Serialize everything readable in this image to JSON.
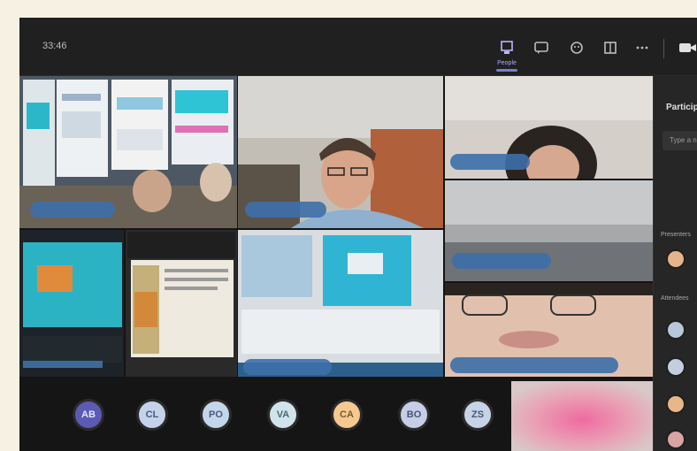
{
  "window": {
    "timer": "33:46"
  },
  "toolbar": {
    "view_label": "People",
    "buttons": [
      "people-view-icon",
      "chat-icon",
      "reactions-icon",
      "rooms-icon",
      "more-icon",
      "camera-icon"
    ]
  },
  "stage": {
    "participants": [
      {
        "name": "",
        "kind": "screen-share"
      },
      {
        "name": "",
        "kind": "camera"
      },
      {
        "name": "",
        "kind": "camera"
      },
      {
        "name": "",
        "kind": "camera"
      },
      {
        "name": "",
        "kind": "screen-share"
      },
      {
        "name": "",
        "kind": "document"
      },
      {
        "name": "",
        "kind": "screen-share"
      },
      {
        "name": "",
        "kind": "camera"
      }
    ]
  },
  "avatar_strip": {
    "avatars": [
      {
        "initials": "AB",
        "color": "#5b5bb5"
      },
      {
        "initials": "CL",
        "color": "#c4d3ea"
      },
      {
        "initials": "PO",
        "color": "#c4d7ea"
      },
      {
        "initials": "VA",
        "color": "#d1e4ec"
      },
      {
        "initials": "CA",
        "color": "#f5c98f"
      },
      {
        "initials": "BO",
        "color": "#c6cee8"
      },
      {
        "initials": "ZS",
        "color": "#c7d3e6"
      }
    ]
  },
  "panel": {
    "title": "Participants",
    "search_placeholder": "Type a name",
    "sections": [
      {
        "label": "Presenters"
      },
      {
        "label": "Attendees"
      }
    ]
  },
  "colors": {
    "background": "#1f1f1f",
    "accent": "#7a7ad6",
    "name_bar": "#3d6fa8"
  }
}
